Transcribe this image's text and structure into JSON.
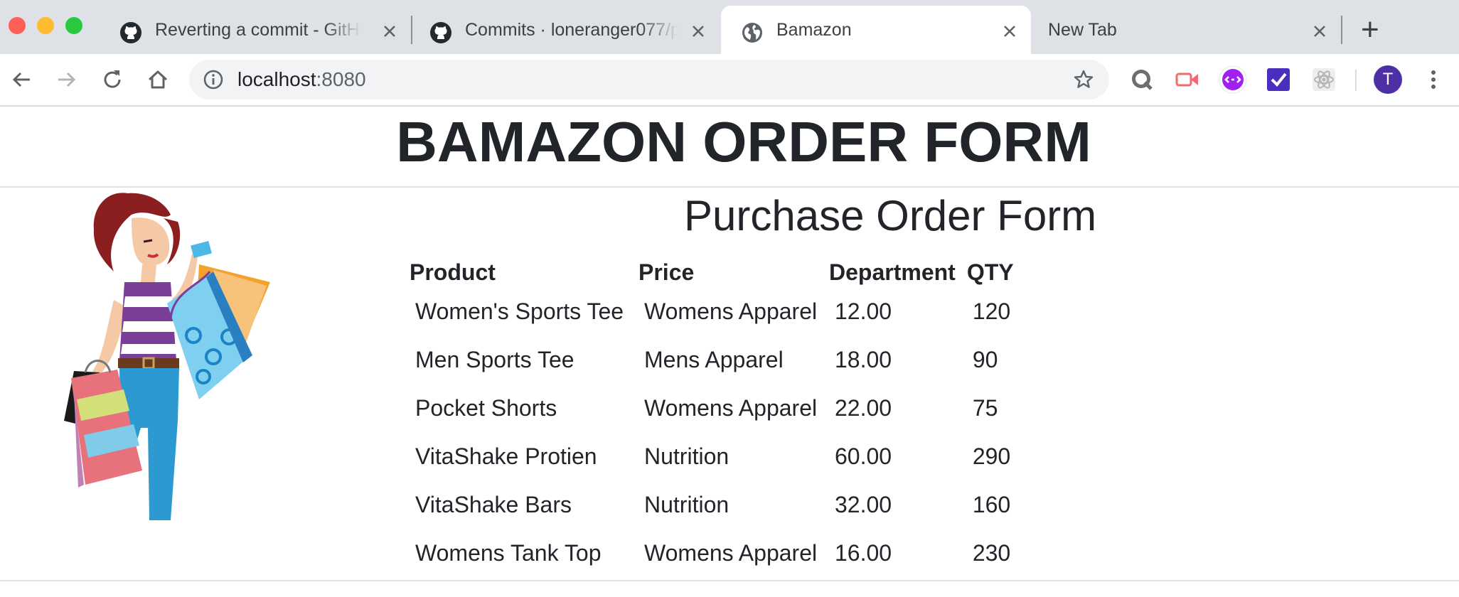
{
  "browser": {
    "tabs": [
      {
        "title": "Reverting a commit - GitHub",
        "favicon": "github-icon"
      },
      {
        "title": "Commits · loneranger077/p",
        "favicon": "github-icon"
      },
      {
        "title": "Bamazon",
        "favicon": "globe-icon",
        "active": true
      },
      {
        "title": "New Tab"
      }
    ],
    "new_tab_symbol": "+",
    "address": {
      "host": "localhost",
      "port": ":8080"
    },
    "profile_initial": "T",
    "colors": {
      "chrome_frame": "#dee1e6",
      "active_tab": "#ffffff",
      "profile": "#4f2fa6"
    }
  },
  "page": {
    "title": "BAMAZON ORDER FORM",
    "subtitle": "Purchase Order Form",
    "table": {
      "headers": [
        "Product",
        "Price",
        "Department",
        "QTY"
      ],
      "rows": [
        [
          "Women's Sports Tee",
          "Womens Apparel",
          "12.00",
          "120"
        ],
        [
          "Men Sports Tee",
          "Mens Apparel",
          "18.00",
          "90"
        ],
        [
          "Pocket Shorts",
          "Womens Apparel",
          "22.00",
          "75"
        ],
        [
          "VitaShake Protien",
          "Nutrition",
          "60.00",
          "290"
        ],
        [
          "VitaShake Bars",
          "Nutrition",
          "32.00",
          "160"
        ],
        [
          "Womens Tank Top",
          "Womens Apparel",
          "16.00",
          "230"
        ]
      ]
    }
  }
}
